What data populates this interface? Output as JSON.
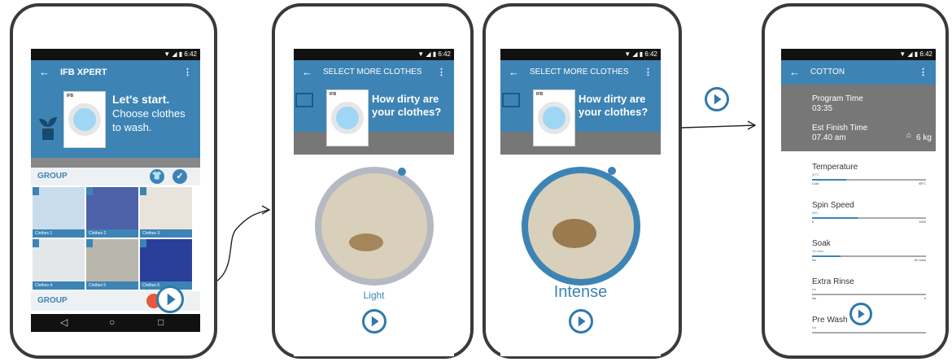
{
  "colors": {
    "primary": "#3d84b5",
    "accent": "#e8583c",
    "header_grey": "#777777"
  },
  "status_time": "6:42",
  "screen1": {
    "title": "IFB XPERT",
    "hero_title": "Let's start.",
    "hero_line2": "Choose clothes",
    "hero_line3": "to wash.",
    "brand": "IFB",
    "group_label": "GROUP",
    "group2_label": "GROUP",
    "clothes": [
      "Clothes 1",
      "Clothes 2",
      "Clothes 3",
      "Clothes 4",
      "Clothes 5",
      "Clothes 6"
    ]
  },
  "screen2": {
    "title": "SELECT MORE CLOTHES",
    "question_line1": "How dirty are",
    "question_line2": "your clothes?",
    "brand": "IFB",
    "level": "Light"
  },
  "screen3": {
    "title": "SELECT MORE CLOTHES",
    "question_line1": "How dirty are",
    "question_line2": "your clothes?",
    "brand": "IFB",
    "level": "Intense"
  },
  "screen4": {
    "title": "COTTON",
    "program_time_label": "Program Time",
    "program_time_value": "03:35",
    "finish_label": "Est Finish Time",
    "finish_value": "07.40 am",
    "weight": "6 kg",
    "settings": [
      {
        "name": "Temperature",
        "current": "30°C",
        "min": "Cold",
        "max": "95°C",
        "fraction": 0.3
      },
      {
        "name": "Spin Speed",
        "current": "400",
        "min": "0",
        "max": "1000",
        "fraction": 0.4
      },
      {
        "name": "Soak",
        "current": "15 mins",
        "min": "No",
        "max": "60 mins",
        "fraction": 0.25
      },
      {
        "name": "Extra Rinse",
        "current": "No",
        "min": "No",
        "max": "3",
        "fraction": 0.0
      },
      {
        "name": "Pre Wash",
        "current": "No",
        "min": "",
        "max": "",
        "fraction": 0.0
      }
    ]
  }
}
